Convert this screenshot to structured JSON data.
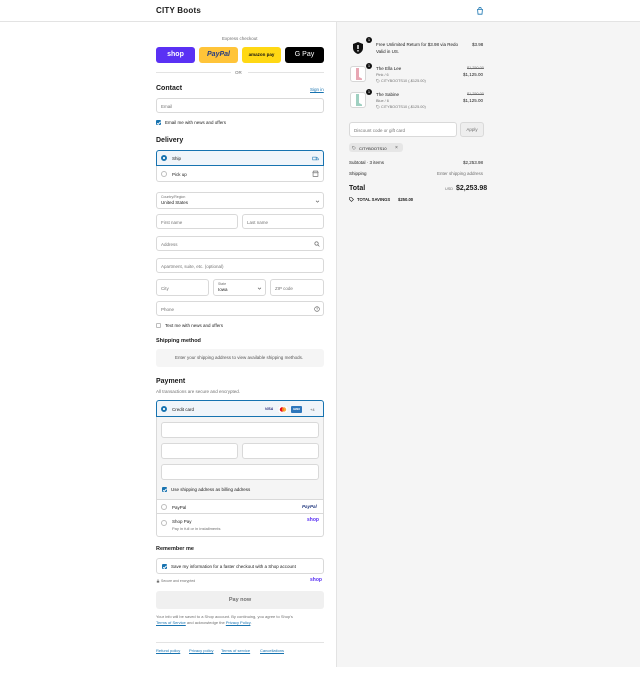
{
  "header": {
    "brand": "CITY Boots",
    "cart_icon": "shopping-bag-icon"
  },
  "express": {
    "label": "Express checkout",
    "buttons": [
      {
        "label": "shop",
        "color": "#5a31f4"
      },
      {
        "label": "PayPal",
        "color": "#ffc439"
      },
      {
        "label": "amazon pay",
        "color": "#ffd814"
      },
      {
        "label": "G Pay",
        "color": "#000000"
      }
    ],
    "or": "OR"
  },
  "contact": {
    "title": "Contact",
    "signin": "Sign in",
    "email_placeholder": "Email",
    "news_label": "Email me with news and offers",
    "news_checked": true
  },
  "delivery": {
    "title": "Delivery",
    "options": [
      {
        "label": "Ship",
        "selected": true
      },
      {
        "label": "Pick up",
        "selected": false
      }
    ],
    "country_label": "Country/Region",
    "country_value": "United States",
    "first_name": "First name",
    "last_name": "Last name",
    "address": "Address",
    "apartment": "Apartment, suite, etc. (optional)",
    "city": "City",
    "state_label": "State",
    "state_value": "Iowa",
    "zip": "ZIP code",
    "phone": "Phone",
    "text_news": "Text me with news and offers"
  },
  "shipping_method": {
    "title": "Shipping method",
    "notice": "Enter your shipping address to view available shipping methods."
  },
  "payment": {
    "title": "Payment",
    "subtitle": "All transactions are secure and encrypted.",
    "credit_card": "Credit card",
    "card_more": "+4",
    "billing_same": "Use shipping address as billing address",
    "paypal": "PayPal",
    "paypal_logo": "PayPal",
    "shoppay": "Shop Pay",
    "shoppay_sub": "Pay in full or in installments",
    "shoppay_logo": "shop"
  },
  "remember": {
    "title": "Remember me",
    "save_label": "Save my information for a faster checkout with a Shop account",
    "secure": "Secure and encrypted",
    "shop_logo": "shop"
  },
  "pay_now": "Pay now",
  "legal": {
    "line1": "Your info will be saved to a Shop account. By continuing, you agree to Shop's",
    "terms": "Terms of Service",
    "and": " and acknowledge the ",
    "privacy": "Privacy Policy",
    "end": "."
  },
  "footer": {
    "links": [
      "Refund policy",
      "Privacy policy",
      "Terms of service",
      "Cancellations"
    ]
  },
  "summary": {
    "items": [
      {
        "qty": "1",
        "title": "Free Unlimited Return for $3.98 via Redo",
        "title2": "Valid in US.",
        "price": "$3.98"
      },
      {
        "qty": "1",
        "title": "The Ella Lee",
        "variant": "Pink / 6",
        "discount": "CITYBOOTS10 (-$125.00)",
        "orig": "$1,250.00",
        "price": "$1,125.00",
        "color": "#e8a7b4"
      },
      {
        "qty": "1",
        "title": "The Sabine",
        "variant": "Blue / 6",
        "discount": "CITYBOOTS10 (-$125.00)",
        "orig": "$1,250.00",
        "price": "$1,125.00",
        "color": "#9fd0c1"
      }
    ],
    "discount_placeholder": "Discount code or gift card",
    "apply": "Apply",
    "code_tag": "CITYBOOTS10",
    "subtotal_label": "Subtotal · 3 items",
    "subtotal_value": "$2,253.98",
    "shipping_label": "Shipping",
    "shipping_value": "Enter shipping address",
    "total_label": "Total",
    "currency": "USD",
    "total_value": "$2,253.98",
    "savings_label": "TOTAL SAVINGS",
    "savings_value": "$250.00"
  }
}
